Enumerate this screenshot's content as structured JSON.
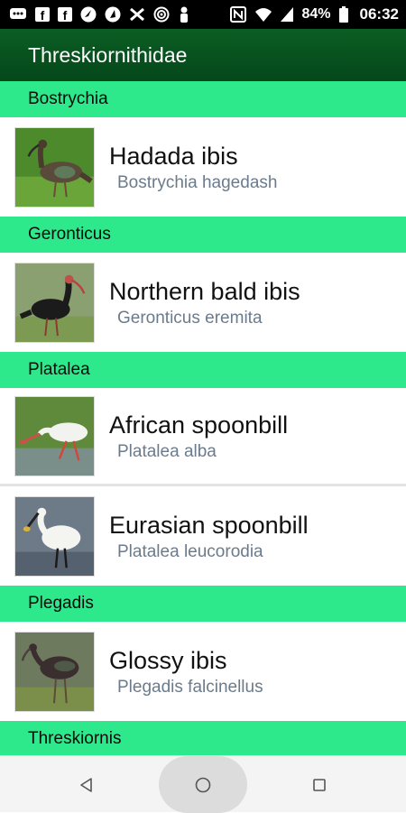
{
  "status_bar": {
    "battery": "84%",
    "time": "06:32",
    "icons": [
      "message-icon",
      "facebook-icon",
      "facebook-icon",
      "app-icon",
      "app-icon",
      "tools-icon",
      "target-icon",
      "person-icon",
      "nfc-icon",
      "wifi-icon",
      "signal-icon",
      "battery-icon"
    ]
  },
  "app_bar": {
    "title": "Threskiornithidae"
  },
  "sections": [
    {
      "header": "Bostrychia",
      "items": [
        {
          "common": "Hadada ibis",
          "scientific": "Bostrychia hagedash"
        }
      ]
    },
    {
      "header": "Geronticus",
      "items": [
        {
          "common": "Northern bald ibis",
          "scientific": "Geronticus eremita"
        }
      ]
    },
    {
      "header": "Platalea",
      "items": [
        {
          "common": "African spoonbill",
          "scientific": "Platalea alba"
        },
        {
          "common": "Eurasian spoonbill",
          "scientific": "Platalea leucorodia"
        }
      ]
    },
    {
      "header": "Plegadis",
      "items": [
        {
          "common": "Glossy ibis",
          "scientific": "Plegadis falcinellus"
        }
      ]
    },
    {
      "header": "Threskiornis",
      "items": []
    }
  ],
  "nav_bar": {
    "icons": [
      "back-icon",
      "home-icon",
      "recents-icon"
    ]
  }
}
